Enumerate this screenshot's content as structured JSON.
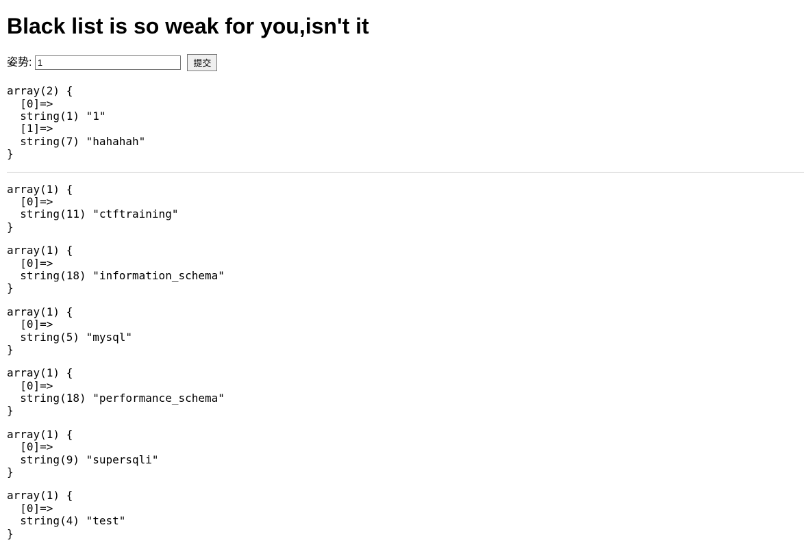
{
  "title": "Black list is so weak for you,isn't it",
  "form": {
    "label": "姿势:",
    "input_value": "1",
    "submit_label": "提交"
  },
  "dumps": {
    "group1": [
      "array(2) {\n  [0]=>\n  string(1) \"1\"\n  [1]=>\n  string(7) \"hahahah\"\n}"
    ],
    "group2": [
      "array(1) {\n  [0]=>\n  string(11) \"ctftraining\"\n}",
      "array(1) {\n  [0]=>\n  string(18) \"information_schema\"\n}",
      "array(1) {\n  [0]=>\n  string(5) \"mysql\"\n}",
      "array(1) {\n  [0]=>\n  string(18) \"performance_schema\"\n}",
      "array(1) {\n  [0]=>\n  string(9) \"supersqli\"\n}",
      "array(1) {\n  [0]=>\n  string(4) \"test\"\n}"
    ]
  }
}
